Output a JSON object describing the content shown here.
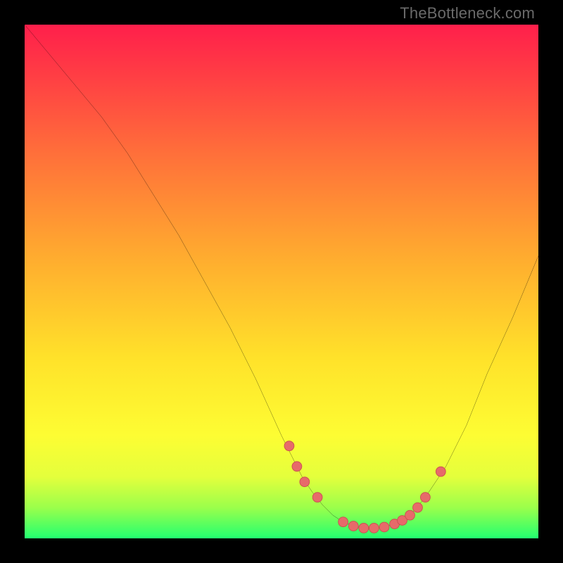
{
  "watermark": "TheBottleneck.com",
  "colors": {
    "background": "#000000",
    "curve": "#000000",
    "marker_fill": "#e76a6a",
    "marker_stroke": "#c94f4f",
    "gradient_top": "#ff1f4b",
    "gradient_mid1": "#ff6f3a",
    "gradient_mid2": "#ffe22a",
    "gradient_mid3": "#e4ff3c",
    "gradient_bottom": "#22ff70"
  },
  "chart_data": {
    "type": "line",
    "title": "",
    "xlabel": "",
    "ylabel": "",
    "xlim": [
      0,
      100
    ],
    "ylim": [
      0,
      100
    ],
    "grid": false,
    "legend": false,
    "x": [
      0,
      5,
      10,
      15,
      20,
      25,
      30,
      35,
      40,
      45,
      50,
      52,
      54,
      56,
      58,
      60,
      62,
      64,
      66,
      68,
      70,
      72,
      75,
      78,
      82,
      86,
      90,
      95,
      100
    ],
    "values": [
      100,
      94,
      88,
      82,
      75,
      67,
      59,
      50,
      41,
      31,
      20,
      16,
      12,
      9,
      6.5,
      4.5,
      3.2,
      2.4,
      2.0,
      2.0,
      2.2,
      2.8,
      4.5,
      8,
      14,
      22,
      32,
      43,
      55
    ],
    "markers": {
      "x": [
        51.5,
        53,
        54.5,
        57,
        62,
        64,
        66,
        68,
        70,
        72,
        73.5,
        75,
        76.5,
        78,
        81
      ],
      "y": [
        18,
        14,
        11,
        8,
        3.2,
        2.4,
        2.0,
        2.0,
        2.2,
        2.8,
        3.5,
        4.5,
        6,
        8,
        13
      ]
    },
    "note": "y values (0=bottom green, 100=top red) read from vertical gradient position; x normalized 0–100 across plot width. Curve is a V-shaped bottleneck curve with minimum near x≈67, y≈2. Pink markers sit along the lower basin of the curve."
  }
}
